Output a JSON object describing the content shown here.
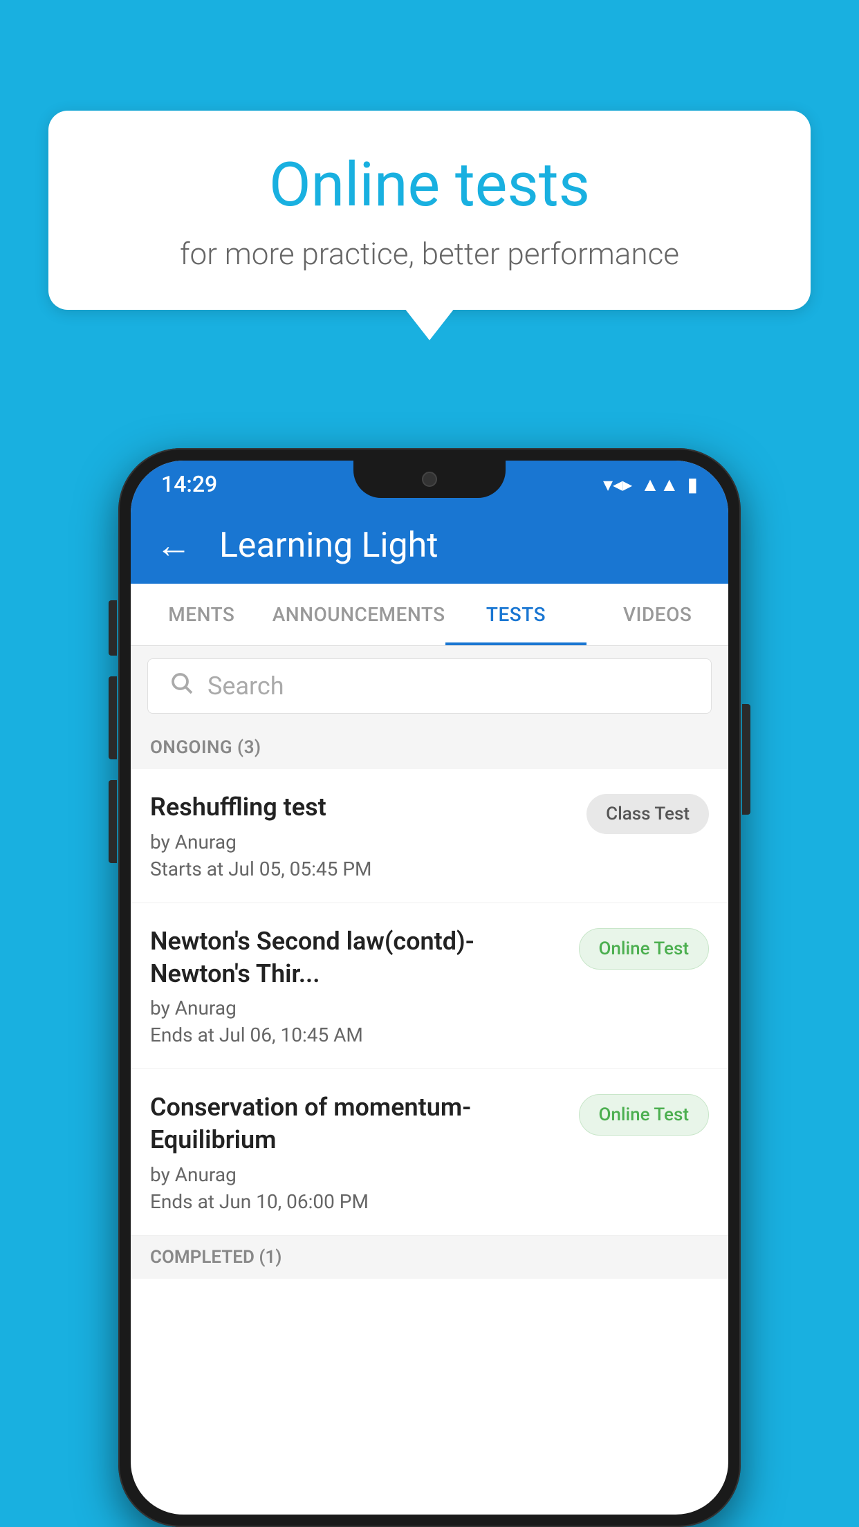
{
  "background_color": "#19b0e0",
  "bubble": {
    "title": "Online tests",
    "subtitle": "for more practice, better performance"
  },
  "phone": {
    "status_bar": {
      "time": "14:29",
      "icons": [
        "wifi",
        "signal",
        "battery"
      ]
    },
    "header": {
      "back_label": "←",
      "title": "Learning Light"
    },
    "tabs": [
      {
        "label": "MENTS",
        "active": false
      },
      {
        "label": "ANNOUNCEMENTS",
        "active": false
      },
      {
        "label": "TESTS",
        "active": true
      },
      {
        "label": "VIDEOS",
        "active": false
      }
    ],
    "search": {
      "placeholder": "Search"
    },
    "ongoing_section": {
      "label": "ONGOING (3)"
    },
    "tests": [
      {
        "title": "Reshuffling test",
        "author": "by Anurag",
        "date": "Starts at  Jul 05, 05:45 PM",
        "badge": "Class Test",
        "badge_type": "class"
      },
      {
        "title": "Newton's Second law(contd)-Newton's Thir...",
        "author": "by Anurag",
        "date": "Ends at  Jul 06, 10:45 AM",
        "badge": "Online Test",
        "badge_type": "online"
      },
      {
        "title": "Conservation of momentum-Equilibrium",
        "author": "by Anurag",
        "date": "Ends at  Jun 10, 06:00 PM",
        "badge": "Online Test",
        "badge_type": "online"
      }
    ],
    "completed_section": {
      "label": "COMPLETED (1)"
    }
  }
}
